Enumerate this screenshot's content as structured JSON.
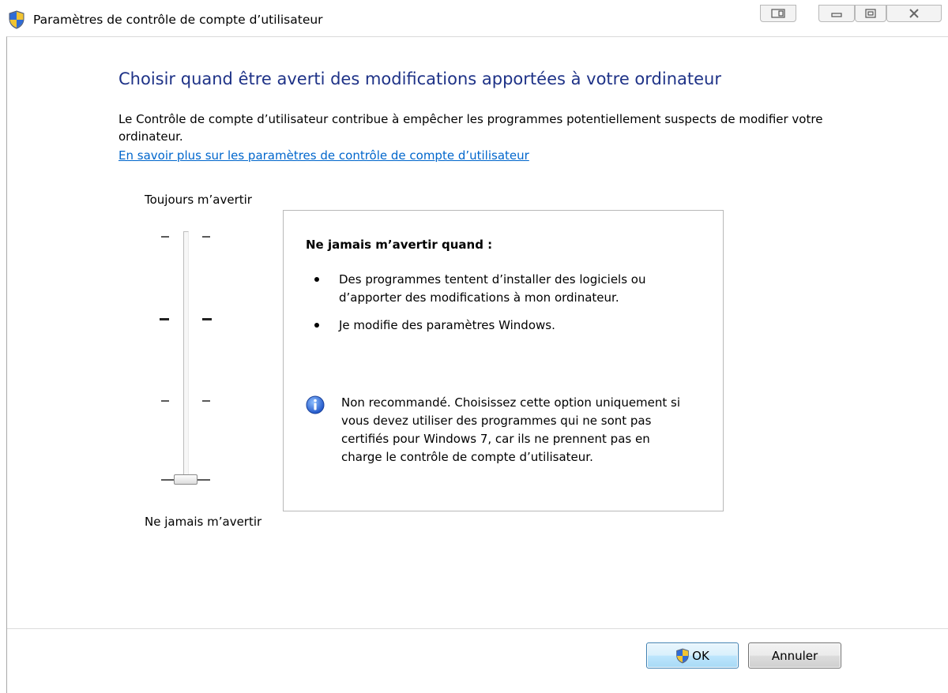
{
  "window": {
    "title": "Paramètres de contrôle de compte d’utilisateur"
  },
  "main": {
    "heading": "Choisir quand être averti des modifications apportées à votre ordinateur",
    "description": "Le Contrôle de compte d’utilisateur contribue à empêcher les programmes potentiellement suspects de modifier votre ordinateur.",
    "learn_more_link": "En savoir plus sur les paramètres de contrôle de compte d’utilisateur"
  },
  "slider": {
    "top_label": "Toujours m’avertir",
    "bottom_label": "Ne jamais m’avertir",
    "levels": 4,
    "selected_level": 1
  },
  "info_panel": {
    "heading": "Ne jamais m’avertir quand :",
    "bullets": [
      "Des programmes tentent d’installer des logiciels ou d’apporter des modifications à mon ordinateur.",
      "Je modifie des paramètres Windows."
    ],
    "note": "Non recommandé. Choisissez cette option uniquement si vous devez utiliser des programmes qui ne sont pas certifiés pour Windows 7, car ils ne prennent pas en charge le contrôle de compte d’utilisateur.",
    "note_icon": "info-icon"
  },
  "buttons": {
    "ok_label": "OK",
    "cancel_label": "Annuler"
  },
  "colors": {
    "heading": "#1e3287",
    "link": "#0066cc"
  }
}
